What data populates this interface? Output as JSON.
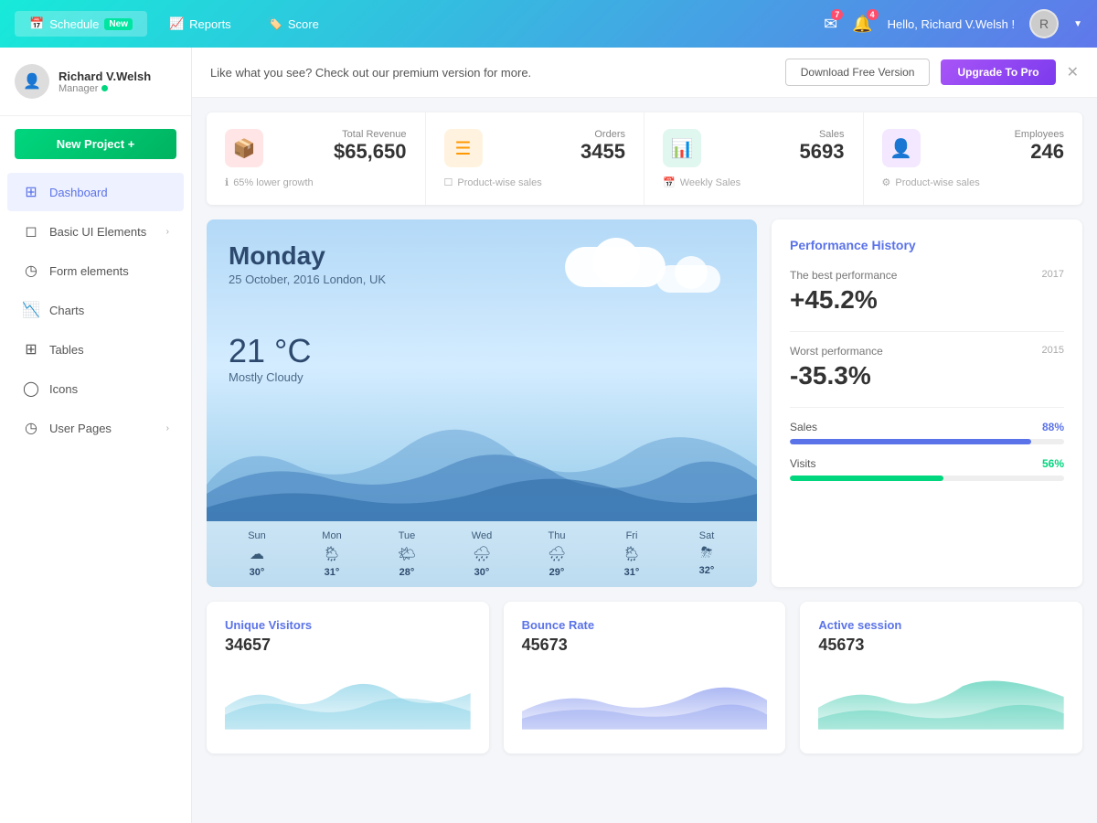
{
  "topnav": {
    "tabs": [
      {
        "id": "schedule",
        "label": "Schedule",
        "badge": "New",
        "icon": "📅",
        "active": true
      },
      {
        "id": "reports",
        "label": "Reports",
        "icon": "📈",
        "active": false
      },
      {
        "id": "score",
        "label": "Score",
        "icon": "🏷️",
        "active": false
      }
    ],
    "notifications_count": "7",
    "alerts_count": "4",
    "greeting": "Hello, Richard V.Welsh !",
    "avatar_initial": "R"
  },
  "sidebar": {
    "user": {
      "name": "Richard V.Welsh",
      "role": "Manager",
      "online": true
    },
    "new_project_label": "New Project +",
    "nav_items": [
      {
        "id": "dashboard",
        "label": "Dashboard",
        "icon": "⊞",
        "active": true
      },
      {
        "id": "basic-ui",
        "label": "Basic UI Elements",
        "icon": "◻",
        "has_arrow": true,
        "active": false
      },
      {
        "id": "form-elements",
        "label": "Form elements",
        "icon": "◷",
        "has_arrow": false,
        "active": false
      },
      {
        "id": "charts",
        "label": "Charts",
        "icon": "📉",
        "has_arrow": false,
        "active": false
      },
      {
        "id": "tables",
        "label": "Tables",
        "icon": "⊞",
        "has_arrow": false,
        "active": false
      },
      {
        "id": "icons",
        "label": "Icons",
        "icon": "◯",
        "has_arrow": false,
        "active": false
      },
      {
        "id": "user-pages",
        "label": "User Pages",
        "icon": "◷",
        "has_arrow": true,
        "active": false
      }
    ]
  },
  "banner": {
    "text": "Like what you see? Check out our premium version for more.",
    "btn_outline": "Download Free Version",
    "btn_purple": "Upgrade To Pro"
  },
  "stats": [
    {
      "id": "revenue",
      "label": "Total Revenue",
      "value": "$65,650",
      "icon": "📦",
      "icon_type": "red",
      "footer": "65% lower growth"
    },
    {
      "id": "orders",
      "label": "Orders",
      "value": "3455",
      "icon": "☰",
      "icon_type": "orange",
      "footer": "Product-wise sales"
    },
    {
      "id": "sales",
      "label": "Sales",
      "value": "5693",
      "icon": "📊",
      "icon_type": "green",
      "footer": "Weekly Sales"
    },
    {
      "id": "employees",
      "label": "Employees",
      "value": "246",
      "icon": "👤",
      "icon_type": "purple",
      "footer": "Product-wise sales"
    }
  ],
  "weather": {
    "day": "Monday",
    "date": "25 October, 2016 London, UK",
    "temp": "21 °C",
    "desc": "Mostly Cloudy",
    "forecast": [
      {
        "day": "Sun",
        "icon": "☁",
        "temp": "30°"
      },
      {
        "day": "Mon",
        "icon": "🌦",
        "temp": "31°"
      },
      {
        "day": "Tue",
        "icon": "🌤",
        "temp": "28°"
      },
      {
        "day": "Wed",
        "icon": "🌧",
        "temp": "30°"
      },
      {
        "day": "Thu",
        "icon": "🌧",
        "temp": "29°"
      },
      {
        "day": "Fri",
        "icon": "🌦",
        "temp": "31°"
      },
      {
        "day": "Sat",
        "icon": "⛈",
        "temp": "32°"
      }
    ]
  },
  "performance": {
    "title": "Performance History",
    "best_label": "The best performance",
    "best_year": "2017",
    "best_value": "+45.2%",
    "worst_label": "Worst performance",
    "worst_year": "2015",
    "worst_value": "-35.3%",
    "metrics": [
      {
        "label": "Sales",
        "pct": 88,
        "pct_label": "88%",
        "color": "blue"
      },
      {
        "label": "Visits",
        "pct": 56,
        "pct_label": "56%",
        "color": "green"
      }
    ]
  },
  "bottom_stats": [
    {
      "id": "unique-visitors",
      "title": "Unique Visitors",
      "value": "34657",
      "color": "#5bc0de"
    },
    {
      "id": "bounce-rate",
      "title": "Bounce Rate",
      "value": "45673",
      "color": "#5b73e8"
    },
    {
      "id": "active-session",
      "title": "Active session",
      "value": "45673",
      "color": "#00b894"
    }
  ]
}
